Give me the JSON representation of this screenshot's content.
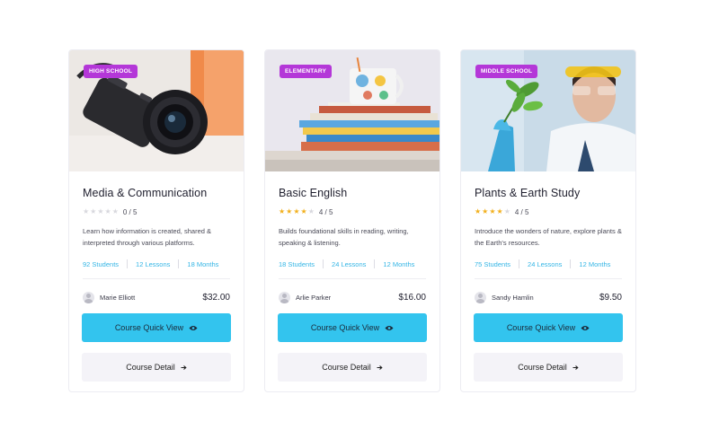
{
  "courses": [
    {
      "badge": "HIGH SCHOOL",
      "title": "Media & Communication",
      "rating_text": "0 / 5",
      "rating_value": 0,
      "description": "Learn how information is created, shared & interpreted through various platforms.",
      "students": "92 Students",
      "lessons": "12 Lessons",
      "duration": "18 Months",
      "author": "Marie Elliott",
      "price": "$32.00",
      "quick_view_label": "Course Quick View",
      "detail_label": "Course Detail"
    },
    {
      "badge": "ELEMENTARY",
      "title": "Basic English",
      "rating_text": "4 / 5",
      "rating_value": 4,
      "description": "Builds foundational skills in reading, writing, speaking & listening.",
      "students": "18 Students",
      "lessons": "24 Lessons",
      "duration": "12 Months",
      "author": "Arlie Parker",
      "price": "$16.00",
      "quick_view_label": "Course Quick View",
      "detail_label": "Course Detail"
    },
    {
      "badge": "MIDDLE SCHOOL",
      "title": "Plants & Earth Study",
      "rating_text": "4 / 5",
      "rating_value": 4,
      "description": "Introduce the wonders of nature, explore plants & the Earth's resources.",
      "students": "75 Students",
      "lessons": "24 Lessons",
      "duration": "12 Months",
      "author": "Sandy Hamlin",
      "price": "$9.50",
      "quick_view_label": "Course Quick View",
      "detail_label": "Course Detail"
    }
  ],
  "colors": {
    "badge": "#b437d8",
    "quick_view": "#33c4ee",
    "detail": "#f4f3f8",
    "meta_link": "#33b5e5",
    "star_on": "#f2b01e",
    "star_off": "#d8d8de"
  },
  "icons": {
    "quick_view": "eye-icon",
    "detail": "arrow-right-icon",
    "rating": "star-icon",
    "author": "avatar-icon"
  }
}
